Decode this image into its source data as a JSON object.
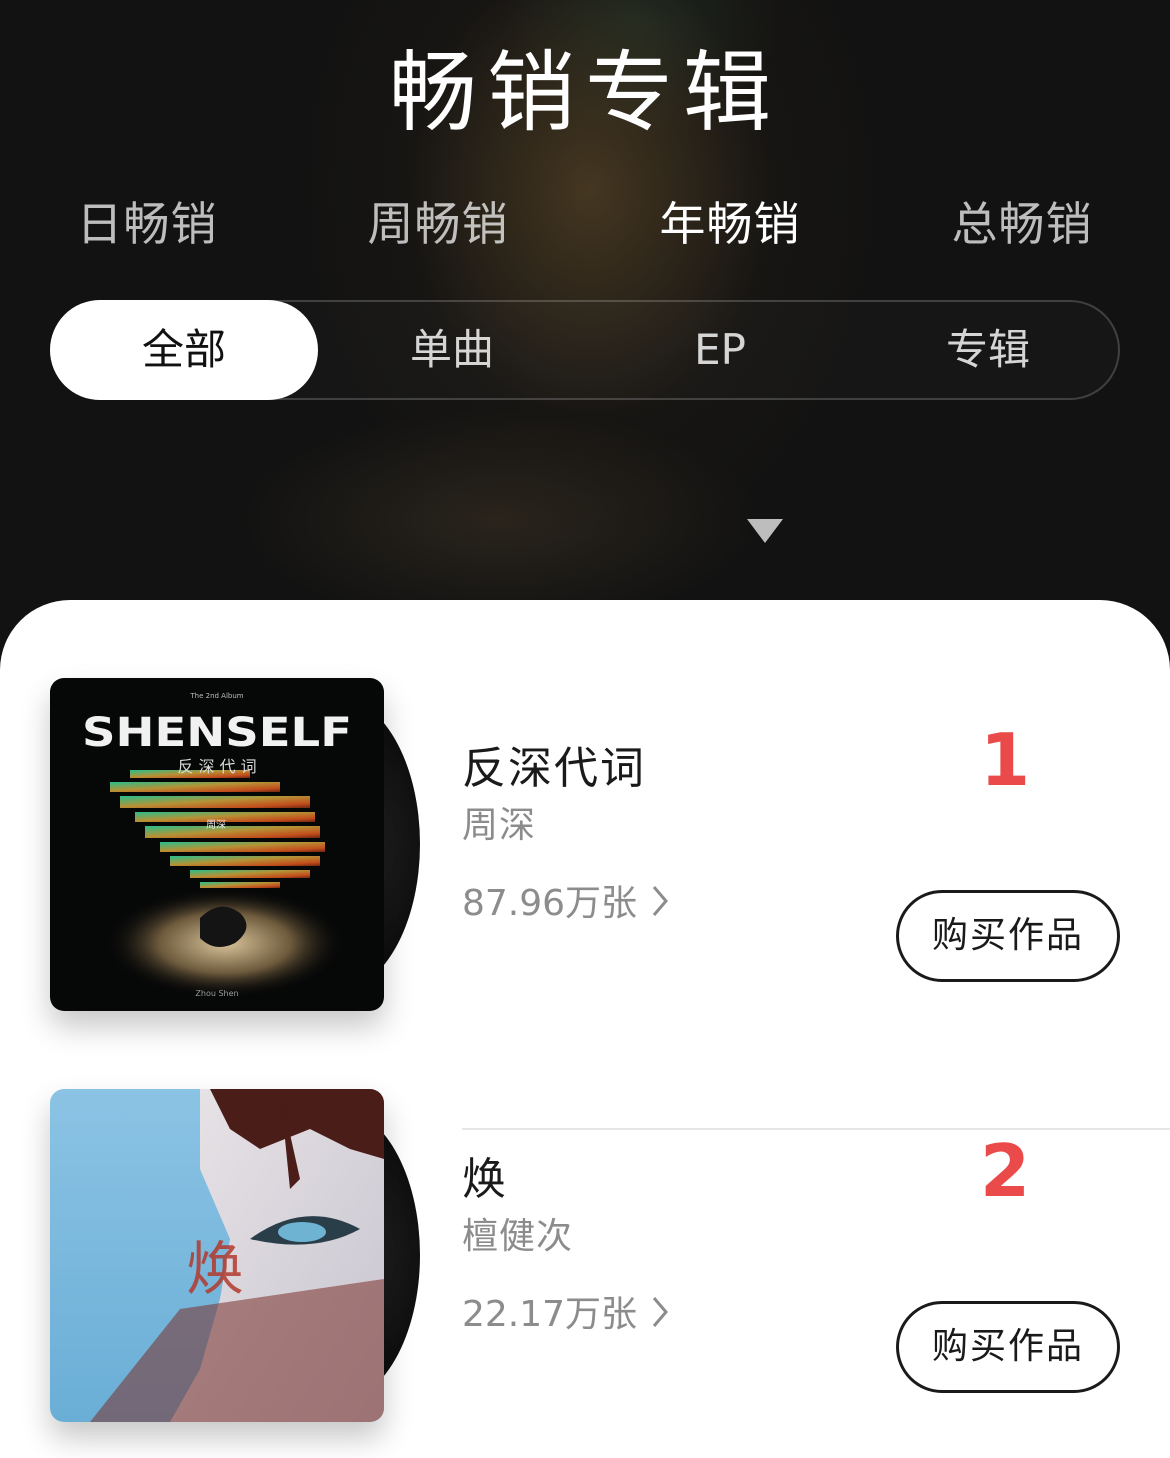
{
  "header": {
    "title": "畅销专辑",
    "period_tabs": [
      {
        "label": "日畅销"
      },
      {
        "label": "周畅销"
      },
      {
        "label": "年畅销"
      },
      {
        "label": "总畅销"
      }
    ],
    "active_period": "年畅销",
    "type_filter": [
      {
        "label": "全部"
      },
      {
        "label": "单曲"
      },
      {
        "label": "EP"
      },
      {
        "label": "专辑"
      }
    ],
    "active_type": "全部",
    "expand_icon": "triangle-down-icon"
  },
  "albums": [
    {
      "rank": "1",
      "title": "反深代词",
      "artist": "周深",
      "sales": "87.96万张",
      "buy_label": "购买作品",
      "cover": {
        "small_caption": "The 2nd Album",
        "logo_text": "SHENSELF",
        "sub_text": "反 深 代 词",
        "vertical_name": "周深",
        "footer": "Zhou Shen"
      }
    },
    {
      "rank": "2",
      "title": "焕",
      "artist": "檀健次",
      "sales": "22.17万张",
      "buy_label": "购买作品",
      "cover": {
        "glyph": "焕"
      }
    }
  ],
  "colors": {
    "rank": "#ea4a4a",
    "header_bg": "#121212",
    "card_bg": "#ffffff"
  }
}
